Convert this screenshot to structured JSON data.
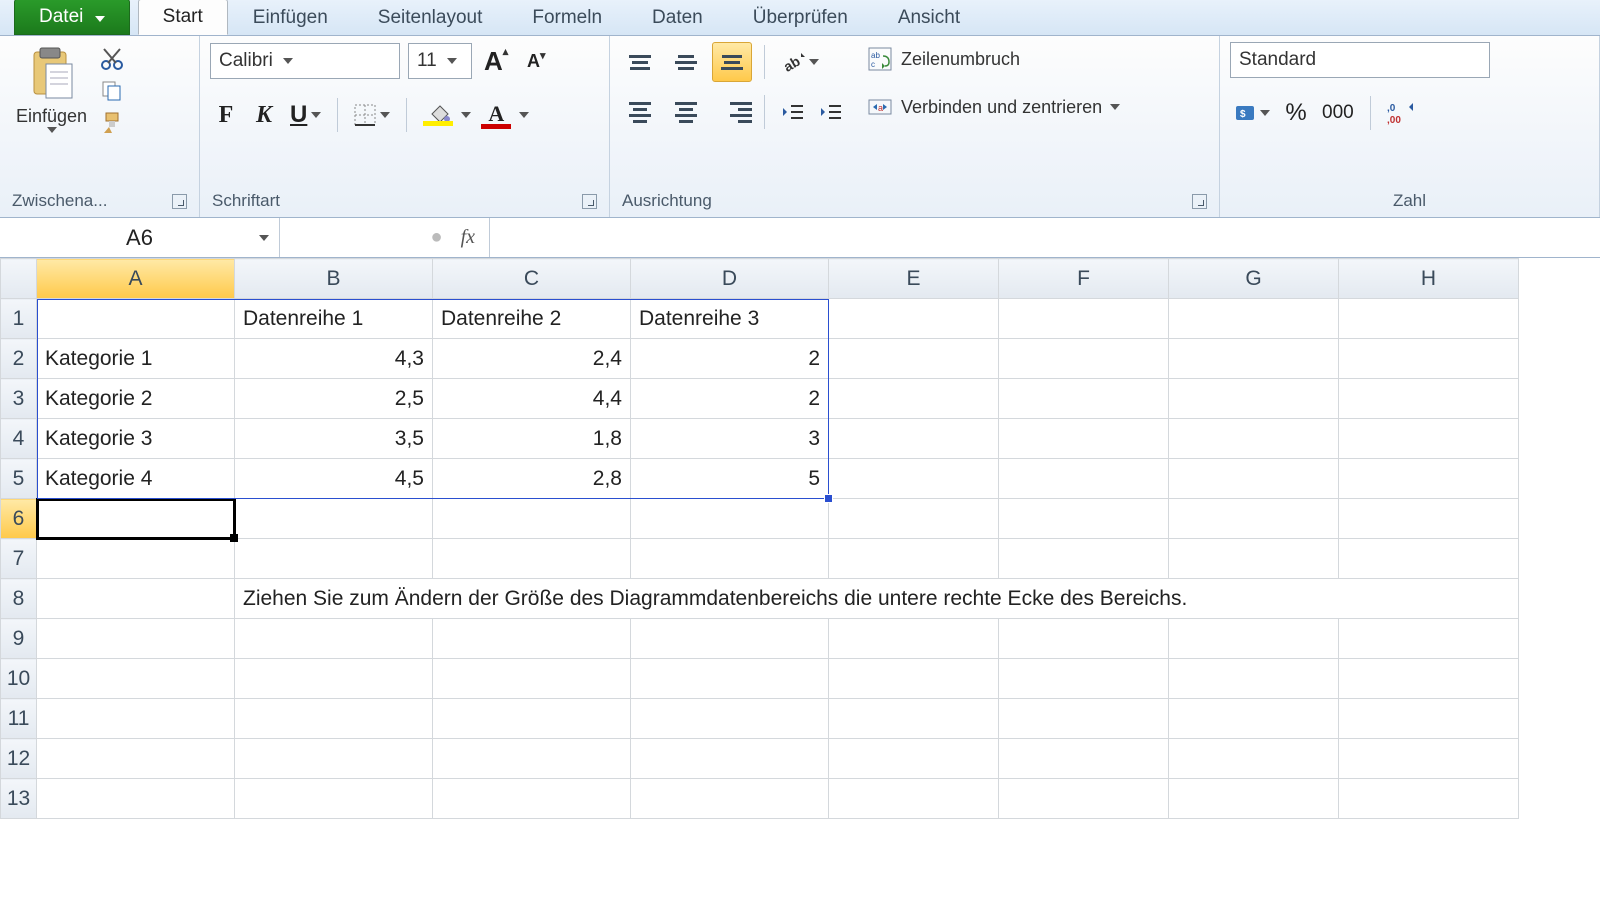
{
  "tabs": {
    "file": "Datei",
    "home": "Start",
    "insert": "Einfügen",
    "layout": "Seitenlayout",
    "formulas": "Formeln",
    "data": "Daten",
    "review": "Überprüfen",
    "view": "Ansicht"
  },
  "ribbon": {
    "clipboard": {
      "paste": "Einfügen",
      "label": "Zwischena..."
    },
    "font": {
      "family": "Calibri",
      "size": "11",
      "bold": "F",
      "italic": "K",
      "underline": "U",
      "increase": "A",
      "decrease": "A",
      "label": "Schriftart"
    },
    "alignment": {
      "wrap": "Zeilenumbruch",
      "merge": "Verbinden und zentrieren",
      "label": "Ausrichtung"
    },
    "number": {
      "format": "Standard",
      "percent": "%",
      "thousands": "000",
      "label": "Zahl"
    }
  },
  "formula_bar": {
    "cell_ref": "A6",
    "fx": "fx",
    "value": ""
  },
  "columns": [
    "A",
    "B",
    "C",
    "D",
    "E",
    "F",
    "G",
    "H"
  ],
  "row_numbers": [
    "1",
    "2",
    "3",
    "4",
    "5",
    "6",
    "7",
    "8",
    "9",
    "10",
    "11",
    "12",
    "13"
  ],
  "headers": {
    "b1": "Datenreihe 1",
    "c1": "Datenreihe 2",
    "d1": "Datenreihe 3"
  },
  "rows": {
    "r2": {
      "a": "Kategorie 1",
      "b": "4,3",
      "c": "2,4",
      "d": "2"
    },
    "r3": {
      "a": "Kategorie 2",
      "b": "2,5",
      "c": "4,4",
      "d": "2"
    },
    "r4": {
      "a": "Kategorie 3",
      "b": "3,5",
      "c": "1,8",
      "d": "3"
    },
    "r5": {
      "a": "Kategorie 4",
      "b": "4,5",
      "c": "2,8",
      "d": "5"
    }
  },
  "hint_row8": "Ziehen Sie zum Ändern der Größe des Diagrammdatenbereichs die untere rechte Ecke des Bereichs.",
  "chart_data": {
    "type": "table",
    "categories": [
      "Kategorie 1",
      "Kategorie 2",
      "Kategorie 3",
      "Kategorie 4"
    ],
    "series": [
      {
        "name": "Datenreihe 1",
        "values": [
          4.3,
          2.5,
          3.5,
          4.5
        ]
      },
      {
        "name": "Datenreihe 2",
        "values": [
          2.4,
          4.4,
          1.8,
          2.8
        ]
      },
      {
        "name": "Datenreihe 3",
        "values": [
          2,
          2,
          3,
          5
        ]
      }
    ]
  }
}
